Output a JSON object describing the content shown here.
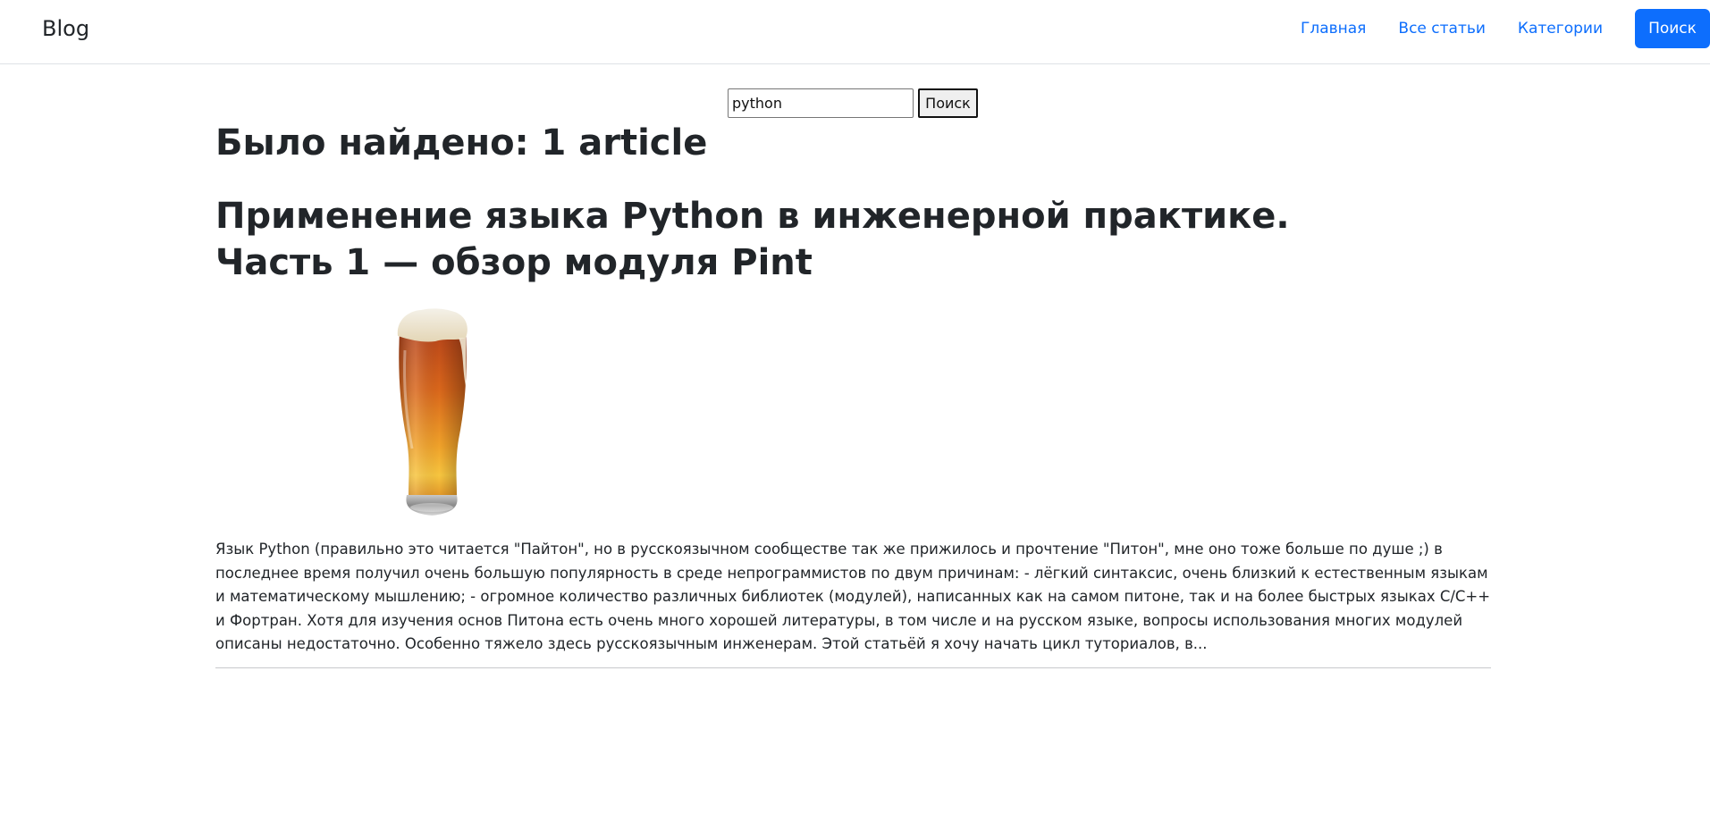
{
  "navbar": {
    "brand": "Blog",
    "links": [
      "Главная",
      "Все статьи",
      "Категории"
    ],
    "button": "Поиск"
  },
  "search": {
    "value": "python",
    "submit": "Поиск"
  },
  "results": {
    "title": "Было найдено: 1 article"
  },
  "article": {
    "title": "Применение языка Python в инженерной практике. Часть 1 — обзор модуля Pint",
    "image_icon": "beer-glass-image",
    "excerpt": "Язык Python (правильно это читается \"Пайтон\", но в русскоязычном сообществе так же прижилось и прочтение \"Питон\", мне оно тоже больше по душе ;) в последнее время получил очень большую популярность в среде непрограммистов по двум причинам: - лёгкий синтаксис, очень близкий к естественным языкам и математическому мышлению; - огромное количество различных библиотек (модулей), написанных как на самом питоне, так и на более быстрых языках C/C++ и Фортран. Хотя для изучения основ Питона есть очень много хорошей литературы, в том числе и на русском языке, вопросы использования многих модулей описаны недостаточно. Особенно тяжело здесь русскоязычным инженерам. Этой статьёй я хочу начать цикл туториалов, в..."
  },
  "colors": {
    "link": "#0d6efd",
    "button_bg": "#0d6efd",
    "text": "#212529",
    "border": "#dee2e6"
  }
}
